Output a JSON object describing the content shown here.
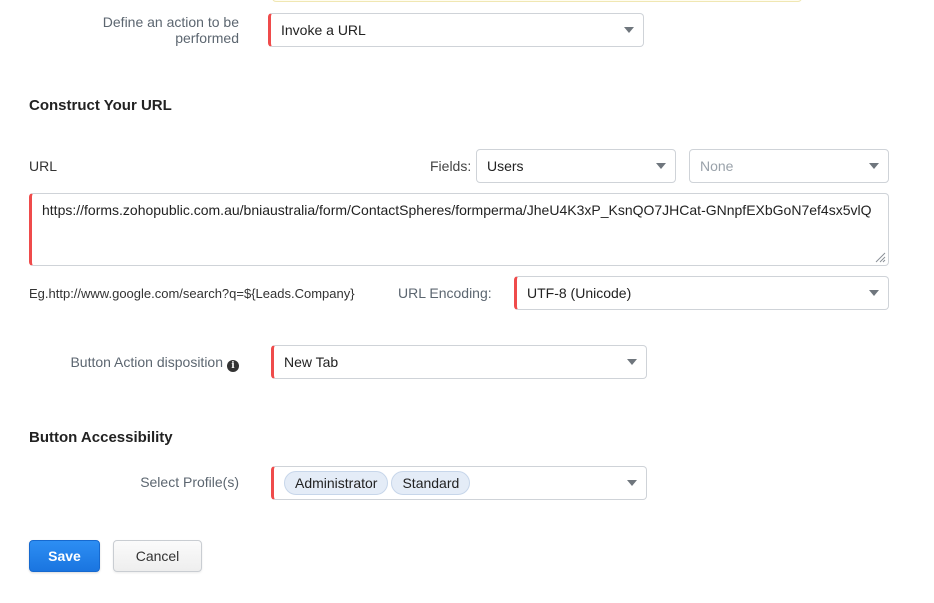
{
  "action": {
    "label": "Define an action to be performed",
    "selected": "Invoke a URL"
  },
  "construct_url": {
    "title": "Construct Your URL",
    "url_label": "URL",
    "fields_label": "Fields:",
    "fields_module": "Users",
    "fields_field": "None",
    "url_value": "https://forms.zohopublic.com.au/bniaustralia/form/ContactSpheres/formperma/JheU4K3xP_KsnQO7JHCat-GNnpfEXbGoN7ef4sx5vlQ",
    "example": "Eg.http://www.google.com/search?q=${Leads.Company}",
    "encoding_label": "URL Encoding:",
    "encoding_value": "UTF-8 (Unicode)"
  },
  "disposition": {
    "label": "Button Action disposition",
    "value": "New Tab"
  },
  "accessibility": {
    "title": "Button Accessibility",
    "profiles_label": "Select Profile(s)",
    "profiles": [
      "Administrator",
      "Standard"
    ]
  },
  "buttons": {
    "save": "Save",
    "cancel": "Cancel"
  },
  "colors": {
    "required_marker": "#ef4b4b",
    "primary": "#1a75e0"
  }
}
